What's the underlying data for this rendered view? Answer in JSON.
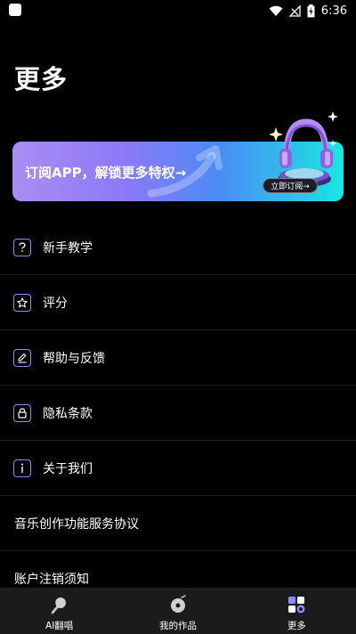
{
  "status_bar": {
    "time": "6:36"
  },
  "page": {
    "title": "更多"
  },
  "banner": {
    "text": "订阅APP，解锁更多特权→",
    "button_label": "立即订阅→"
  },
  "menu": {
    "items": [
      {
        "label": "新手教学",
        "icon": "question-icon"
      },
      {
        "label": "评分",
        "icon": "star-icon"
      },
      {
        "label": "帮助与反馈",
        "icon": "edit-icon"
      },
      {
        "label": "隐私条款",
        "icon": "lock-icon"
      },
      {
        "label": "关于我们",
        "icon": "info-icon"
      },
      {
        "label": "音乐创作功能服务协议"
      },
      {
        "label": "账户注销须知"
      }
    ]
  },
  "tabs": [
    {
      "label": "AI翻唱",
      "icon": "ai-cover-icon",
      "active": false
    },
    {
      "label": "我的作品",
      "icon": "record-icon",
      "active": false
    },
    {
      "label": "更多",
      "icon": "more-icon",
      "active": true
    }
  ],
  "colors": {
    "accent": "#8f8cf9",
    "banner_start": "#a98df3",
    "banner_end": "#19e6e1",
    "tab_bar": "#1b1b1b"
  }
}
